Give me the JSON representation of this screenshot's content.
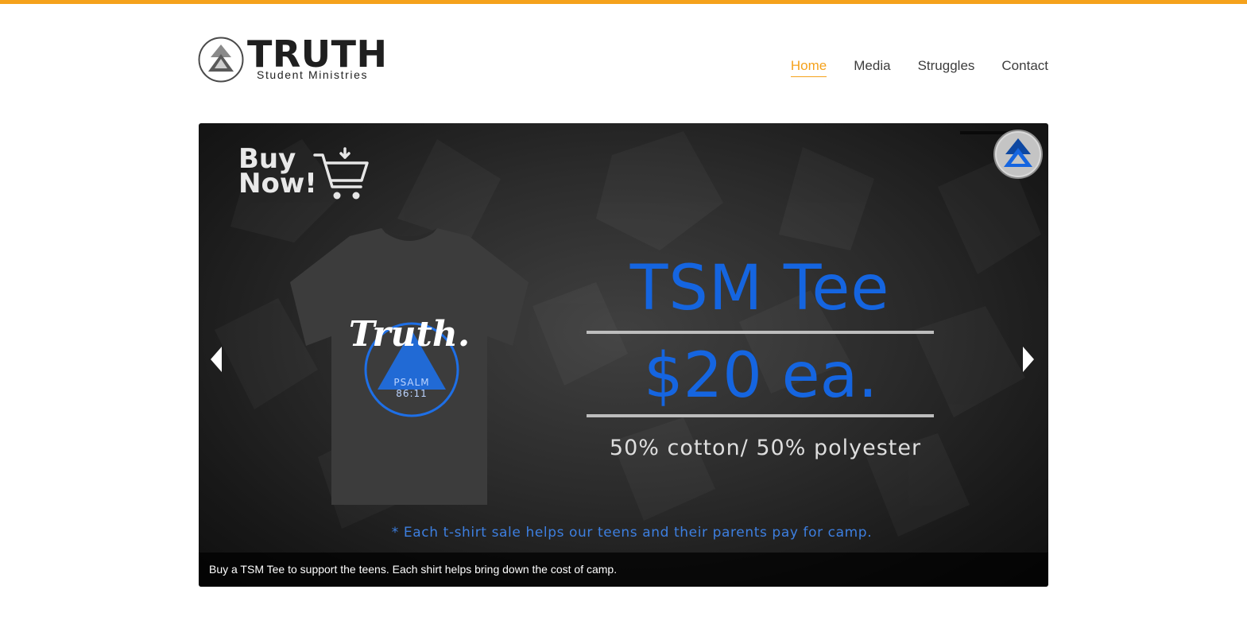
{
  "colors": {
    "accent": "#f5a21c",
    "brand_blue": "#1565e0",
    "text_dark": "#3d3d3d"
  },
  "header": {
    "logo_title": "TRUTH",
    "logo_subtitle": "Student Ministries",
    "logo_icon": "double-arrow-up-icon"
  },
  "nav": {
    "items": [
      {
        "label": "Home",
        "active": true
      },
      {
        "label": "Media",
        "active": false
      },
      {
        "label": "Struggles",
        "active": false
      },
      {
        "label": "Contact",
        "active": false
      }
    ]
  },
  "slide": {
    "buy_line1": "Buy",
    "buy_line2": "Now!",
    "cart_icon": "shopping-cart-icon",
    "shirt_print_title": "Truth.",
    "shirt_print_verse1": "PSALM",
    "shirt_print_verse2": "86:11",
    "title": "TSM Tee",
    "price": "$20 ea.",
    "fabric": "50% cotton/ 50% polyester",
    "note": "* Each t-shirt sale helps our teens and their parents pay for camp.",
    "caption": "Buy a TSM Tee to support the teens. Each shirt helps bring down the cost of camp.",
    "prev_icon": "chevron-left-icon",
    "next_icon": "chevron-right-icon",
    "badge_icon": "double-arrow-up-icon"
  }
}
